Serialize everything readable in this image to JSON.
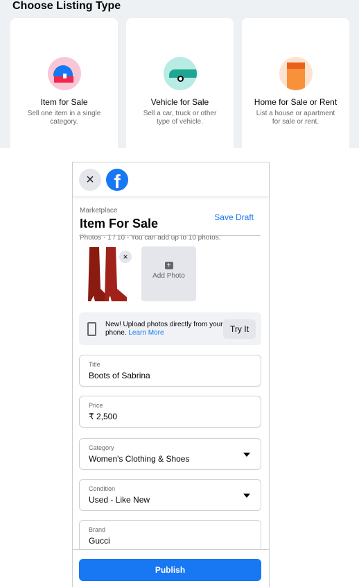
{
  "listing_type": {
    "title": "Choose Listing Type",
    "cards": [
      {
        "title": "Item for Sale",
        "desc": "Sell one item in a single category.",
        "icon": "shopping-bag-icon"
      },
      {
        "title": "Vehicle for Sale",
        "desc": "Sell a car, truck or other type of vehicle.",
        "icon": "car-icon"
      },
      {
        "title": "Home for Sale or Rent",
        "desc": "List a house or apartment for sale or rent.",
        "icon": "house-icon"
      }
    ]
  },
  "panel": {
    "close": "×",
    "logo": "f",
    "section": "Marketplace",
    "title": "Item For Sale",
    "save_draft": "Save Draft",
    "photos_hint": "Photos · 1 / 10 - You can add up to 10 photos.",
    "remove": "×",
    "add_photo": "Add Photo",
    "add_icon": "+",
    "promo": {
      "text": "New! Upload photos directly from your phone.",
      "link": "Learn More",
      "button": "Try It"
    },
    "fields": [
      {
        "label": "Title",
        "value": "Boots of Sabrina"
      },
      {
        "label": "Price",
        "value": "₹ 2,500"
      },
      {
        "label": "Category",
        "value": "Women's Clothing & Shoes"
      },
      {
        "label": "Condition",
        "value": "Used - Like New"
      },
      {
        "label": "Brand",
        "value": "Gucci"
      }
    ],
    "publish": "Publish"
  },
  "colors": {
    "accent": "#1877f2"
  }
}
